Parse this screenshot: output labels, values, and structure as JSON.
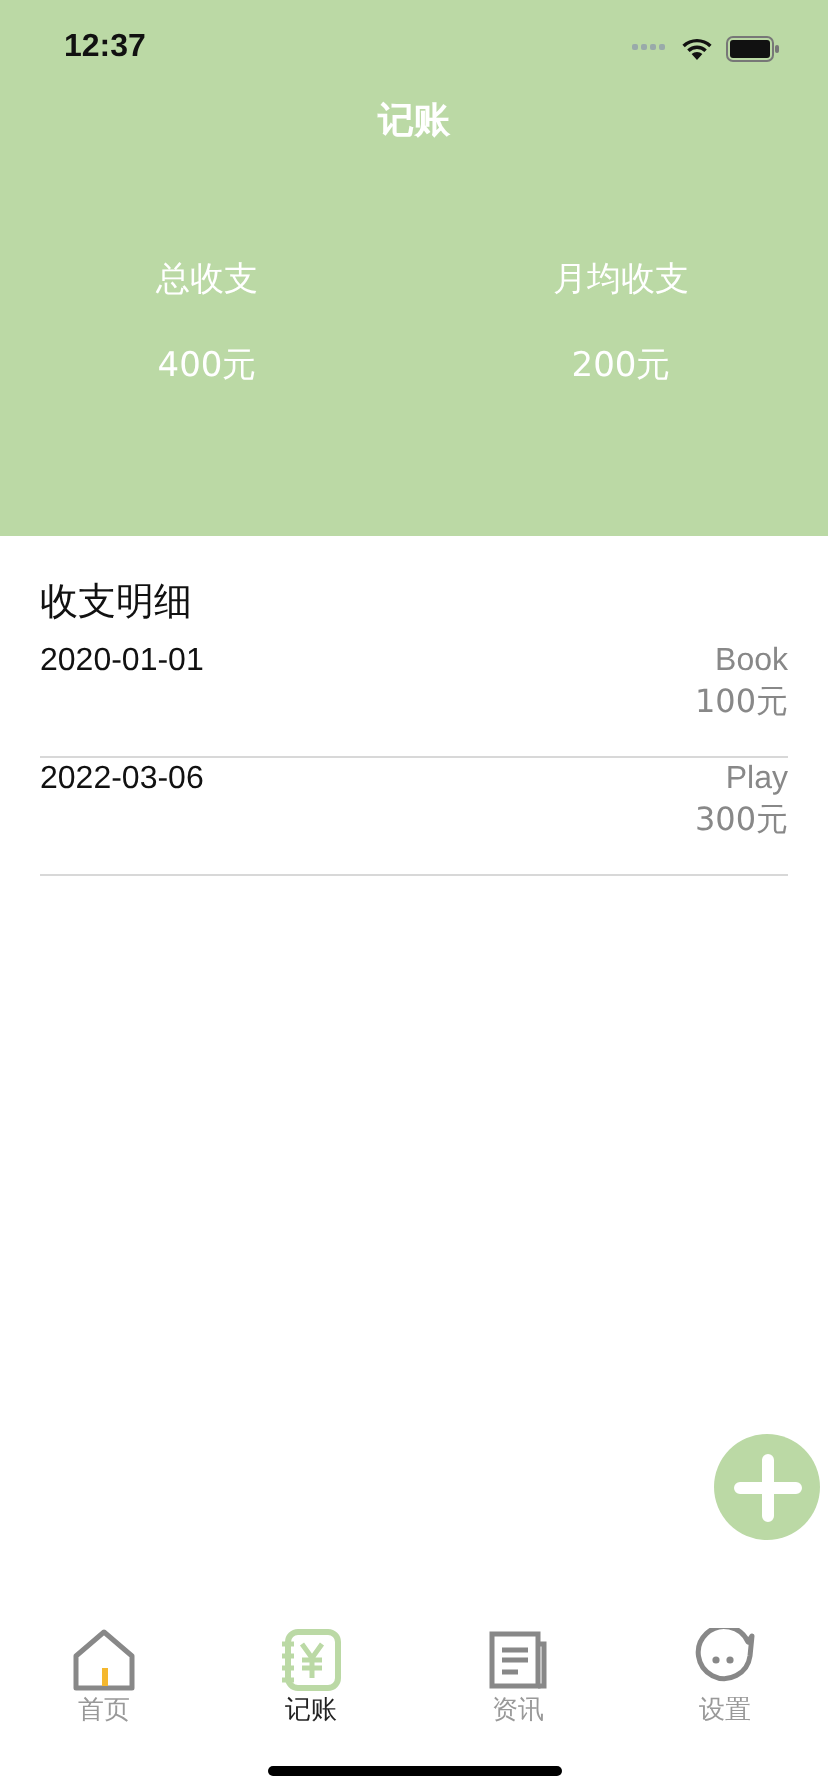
{
  "status_bar": {
    "time": "12:37"
  },
  "header": {
    "title": "记账",
    "stats": [
      {
        "label": "总收支",
        "value": "400元"
      },
      {
        "label": "月均收支",
        "value": "200元"
      }
    ]
  },
  "details": {
    "title": "收支明细",
    "rows": [
      {
        "date": "2020-01-01",
        "category": "Book",
        "amount": "100元"
      },
      {
        "date": "2022-03-06",
        "category": "Play",
        "amount": "300元"
      }
    ]
  },
  "tabs": [
    {
      "kind": "home",
      "label": "首页",
      "selected": false
    },
    {
      "kind": "ledger",
      "label": "记账",
      "selected": true
    },
    {
      "kind": "news",
      "label": "资讯",
      "selected": false
    },
    {
      "kind": "settings",
      "label": "设置",
      "selected": false
    }
  ]
}
